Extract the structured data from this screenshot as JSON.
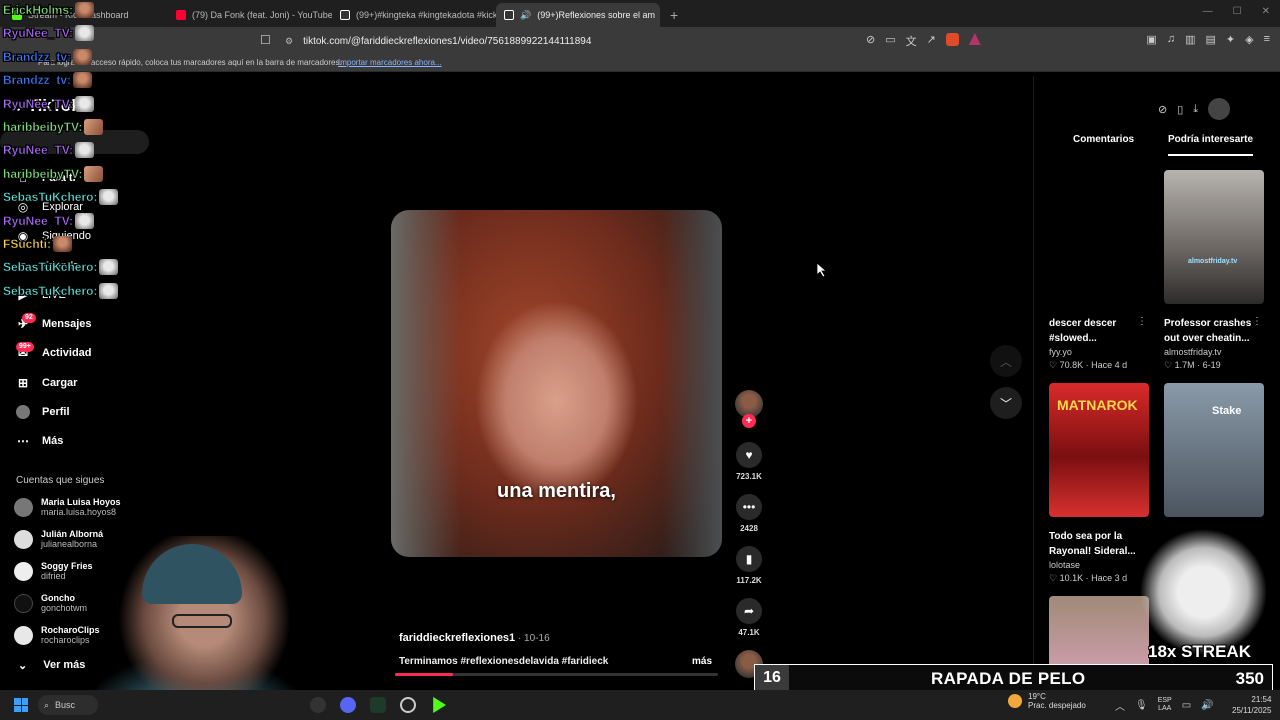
{
  "browser": {
    "tabs": [
      {
        "title": "Stream - Kick Dashboard",
        "color": "#53fc18"
      },
      {
        "title": "(79) Da Fonk (feat. Joni) - YouTube",
        "color": "#ff0033"
      },
      {
        "title": "(99+)#kingteka #kingtekadota #kick",
        "color": "#ffffff"
      },
      {
        "title": "(99+)Reflexiones sobre el am",
        "color": "#ffffff"
      }
    ],
    "new_tab": "+",
    "url": "tiktok.com/@fariddieckreflexiones1/video/7561889922144111894",
    "bookmarks_msg": "Para lograr un acceso rápido, coloca tus marcadores aquí en la barra de marcadores.",
    "bookmarks_link": "Importar marcadores ahora..."
  },
  "chat": [
    {
      "name": "ErickHolms:",
      "color": "#7fe07a",
      "emote": "face"
    },
    {
      "name": "RyuNee_TV:",
      "color": "#b06cff",
      "emote": "cat"
    },
    {
      "name": "Brandzz_tv:",
      "color": "#3d7cff",
      "emote": "face"
    },
    {
      "name": "Brandzz_tv:",
      "color": "#3d7cff",
      "emote": "face"
    },
    {
      "name": "RyuNee_TV:",
      "color": "#b06cff",
      "emote": "cat"
    },
    {
      "name": "haribbeibyTV:",
      "color": "#7fe07a",
      "emote": "hand"
    },
    {
      "name": "RyuNee_TV:",
      "color": "#b06cff",
      "emote": "cat"
    },
    {
      "name": "haribbeibyTV:",
      "color": "#7fe07a",
      "emote": "hand"
    },
    {
      "name": "SebasTuKchero:",
      "color": "#58e0d8",
      "emote": "cat"
    },
    {
      "name": "RyuNee_TV:",
      "color": "#b06cff",
      "emote": "cat"
    },
    {
      "name": "FSuchti:",
      "color": "#ffd84a",
      "emote": "face"
    },
    {
      "name": "SebasTuKchero:",
      "color": "#58e0d8",
      "emote": "cat"
    },
    {
      "name": "SebasTuKchero:",
      "color": "#58e0d8",
      "emote": "cat"
    }
  ],
  "sidebar": {
    "logo": "TikTok",
    "nav": [
      {
        "label": "Para ti",
        "icon": "home-icon"
      },
      {
        "label": "Explorar",
        "icon": "compass-icon"
      },
      {
        "label": "Siguiendo",
        "icon": "following-icon"
      },
      {
        "label": "Friends",
        "icon": "friends-icon"
      },
      {
        "label": "LIVE",
        "icon": "live-icon"
      },
      {
        "label": "Mensajes",
        "icon": "message-icon",
        "badge": "92"
      },
      {
        "label": "Actividad",
        "icon": "activity-icon",
        "badge": "99+"
      },
      {
        "label": "Cargar",
        "icon": "upload-icon"
      },
      {
        "label": "Perfil",
        "icon": "profile-icon"
      },
      {
        "label": "Más",
        "icon": "more-icon"
      }
    ],
    "following_title": "Cuentas que sigues",
    "following": [
      {
        "name": "Maria Luisa Hoyos",
        "handle": "maria.luisa.hoyos8"
      },
      {
        "name": "Julián Alborná",
        "handle": "julianealborna"
      },
      {
        "name": "Soggy Fries",
        "handle": "difried"
      },
      {
        "name": "Goncho",
        "handle": "gonchotwm"
      },
      {
        "name": "RocharoClips",
        "handle": "rocharoclips"
      }
    ],
    "see_more": "Ver más"
  },
  "video": {
    "subtitle": "una mentira,",
    "author": "fariddieckreflexiones1",
    "date": " · 10-16",
    "caption": "Terminamos #reflexionesdelavida #faridieck",
    "more": "más",
    "progress": 0.18,
    "likes": "723.1K",
    "comments": "2428",
    "saves": "117.2K",
    "shares": "47.1K"
  },
  "right_panel": {
    "tabs": [
      "Comentarios",
      "Podría interesarte"
    ],
    "active_tab": "Podría interesarte",
    "cards": [
      {
        "title_1": "descer descer",
        "title_2": "#slowed...",
        "author": "fyy.yo",
        "stats": "♡ 70.8K · Hace 4 d",
        "thumb_label": ""
      },
      {
        "title_1": "Professor crashes",
        "title_2": "out over cheatin...",
        "author": "almostfriday.tv",
        "stats": "♡ 1.7M · 6-19",
        "thumb_label": "almostfriday.tv"
      },
      {
        "title_1": "Todo sea por la",
        "title_2": "Rayonal! Sideral...",
        "author": "lolotase",
        "stats": "♡ 10.1K · Hace 3 d",
        "thumb_label": "MATNAROK"
      },
      {
        "title_1": "",
        "title_2": "",
        "author": "",
        "stats": "",
        "thumb_label": "Stake"
      }
    ]
  },
  "overlay": {
    "banner_number": "16",
    "banner_text": "RAPADA DE PELO",
    "banner_points": "350",
    "streak": "18x STREAK"
  },
  "taskbar": {
    "search": "Busc",
    "weather_temp": "19°C",
    "weather_desc": "Prac. despejado",
    "lang_1": "ESP",
    "lang_2": "LAA",
    "time": "21:54",
    "date": "25/11/2025"
  }
}
